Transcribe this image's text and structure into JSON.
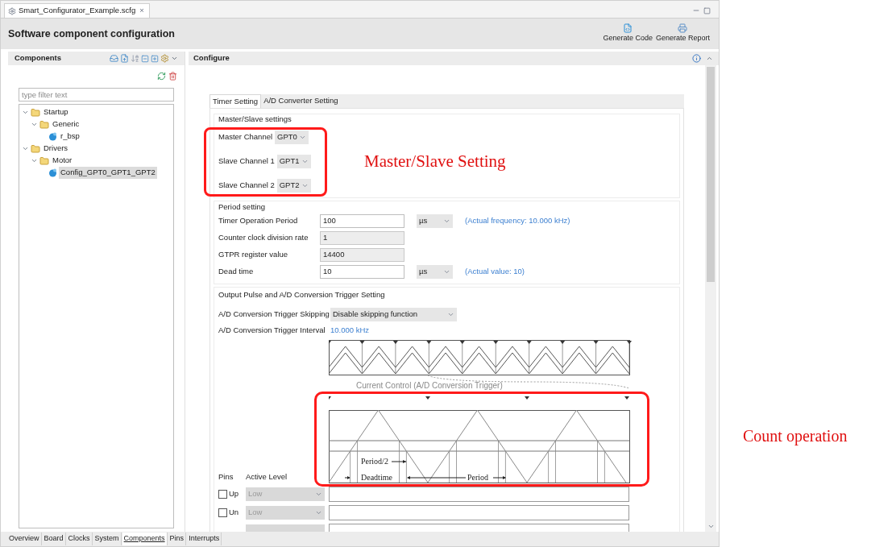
{
  "editor_tab": {
    "title": "Smart_Configurator_Example.scfg",
    "close": "×"
  },
  "header": {
    "title": "Software component configuration",
    "buttons": [
      {
        "kind": "code",
        "label": "Generate Code"
      },
      {
        "kind": "report",
        "label": "Generate Report"
      }
    ]
  },
  "components_panel": {
    "title": "Components",
    "filter": {
      "placeholder": "type filter text"
    },
    "tree": [
      {
        "kind": "folder",
        "label": "Startup",
        "expanded": true,
        "selected": false,
        "children": [
          {
            "kind": "folder",
            "label": "Generic",
            "expanded": true,
            "selected": false,
            "children": [
              {
                "kind": "component",
                "label": "r_bsp",
                "selected": false
              }
            ]
          }
        ]
      },
      {
        "kind": "folder",
        "label": "Drivers",
        "expanded": true,
        "selected": false,
        "children": [
          {
            "kind": "folder",
            "label": "Motor",
            "expanded": true,
            "selected": false,
            "children": [
              {
                "kind": "component",
                "label": "Config_GPT0_GPT1_GPT2",
                "selected": true
              }
            ]
          }
        ]
      }
    ]
  },
  "configure_panel": {
    "title": "Configure",
    "tabs": [
      {
        "label": "Timer Setting",
        "selected": true
      },
      {
        "label": "A/D Converter Setting",
        "selected": false
      }
    ],
    "master_slave": {
      "title": "Master/Slave settings",
      "rows": [
        {
          "label": "Master Channel",
          "value": "GPT0"
        },
        {
          "label": "Slave Channel 1",
          "value": "GPT1"
        },
        {
          "label": "Slave Channel 2",
          "value": "GPT2"
        }
      ]
    },
    "period": {
      "title": "Period setting",
      "rows": [
        {
          "kind": "input",
          "label": "Timer Operation Period",
          "value": "100",
          "unit": "µs",
          "note": "(Actual frequency: 10.000 kHz)"
        },
        {
          "kind": "readonly",
          "label": "Counter clock division rate",
          "value": "1"
        },
        {
          "kind": "readonly",
          "label": "GTPR register value",
          "value": "14400"
        },
        {
          "kind": "input",
          "label": "Dead time",
          "value": "10",
          "unit": "µs",
          "note": "(Actual value: 10)"
        }
      ]
    },
    "output": {
      "title": "Output Pulse and A/D Conversion Trigger Setting",
      "skipping": {
        "label": "A/D Conversion Trigger Skipping",
        "value": "Disable skipping function"
      },
      "interval": {
        "label": "A/D Conversion Trigger Interval",
        "value": "10.000 kHz"
      },
      "diagram": {
        "caption": "Current Control (A/D Conversion Trigger)",
        "half_period": "Period/2",
        "deadtime": "Deadtime",
        "period": "Period"
      },
      "pins_heading": "Pins",
      "active_level_heading": "Active Level",
      "pins": [
        {
          "label": "Up",
          "checked": false,
          "active_level": "Low"
        },
        {
          "label": "Un",
          "checked": false,
          "active_level": "Low"
        }
      ]
    }
  },
  "bottom_tabs": [
    {
      "label": "Overview",
      "selected": false
    },
    {
      "label": "Board",
      "selected": false
    },
    {
      "label": "Clocks",
      "selected": false
    },
    {
      "label": "System",
      "selected": false
    },
    {
      "label": "Components",
      "selected": true
    },
    {
      "label": "Pins",
      "selected": false
    },
    {
      "label": "Interrupts",
      "selected": false
    }
  ],
  "annotations": [
    {
      "kind": "master_slave",
      "label": "Master/Slave Setting"
    },
    {
      "kind": "count",
      "label": "Count operation"
    }
  ]
}
